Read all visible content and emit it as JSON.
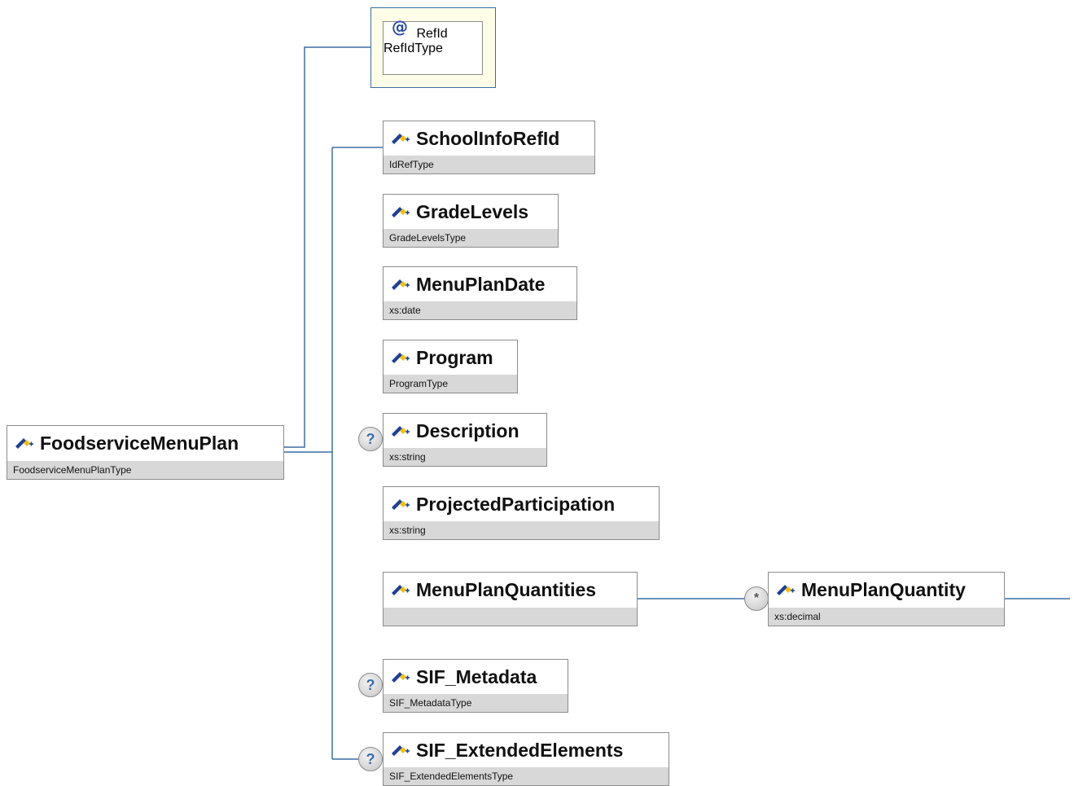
{
  "root": {
    "name": "FoodserviceMenuPlan",
    "type": "FoodserviceMenuPlanType"
  },
  "attribute": {
    "symbol": "@",
    "name": "RefId",
    "type": "RefIdType"
  },
  "children": [
    {
      "name": "SchoolInfoRefId",
      "type": "IdRefType",
      "optional": false
    },
    {
      "name": "GradeLevels",
      "type": "GradeLevelsType",
      "optional": false
    },
    {
      "name": "MenuPlanDate",
      "type": "xs:date",
      "optional": false
    },
    {
      "name": "Program",
      "type": "ProgramType",
      "optional": false
    },
    {
      "name": "Description",
      "type": "xs:string",
      "optional": true
    },
    {
      "name": "ProjectedParticipation",
      "type": "xs:string",
      "optional": false
    },
    {
      "name": "MenuPlanQuantities",
      "type": "",
      "optional": false
    },
    {
      "name": "SIF_Metadata",
      "type": "SIF_MetadataType",
      "optional": true
    },
    {
      "name": "SIF_ExtendedElements",
      "type": "SIF_ExtendedElementsType",
      "optional": true
    }
  ],
  "grandchild": {
    "name": "MenuPlanQuantity",
    "type": "xs:decimal",
    "multiplicity": "*"
  },
  "badges": {
    "optional": "?",
    "repeat": "*"
  },
  "colors": {
    "connector": "#3b6ea5",
    "typeBar": "#d8d8d8",
    "nodeBorder": "#8c8c8c",
    "iconBlue": "#1f3f99",
    "iconYellow": "#f2c200"
  }
}
